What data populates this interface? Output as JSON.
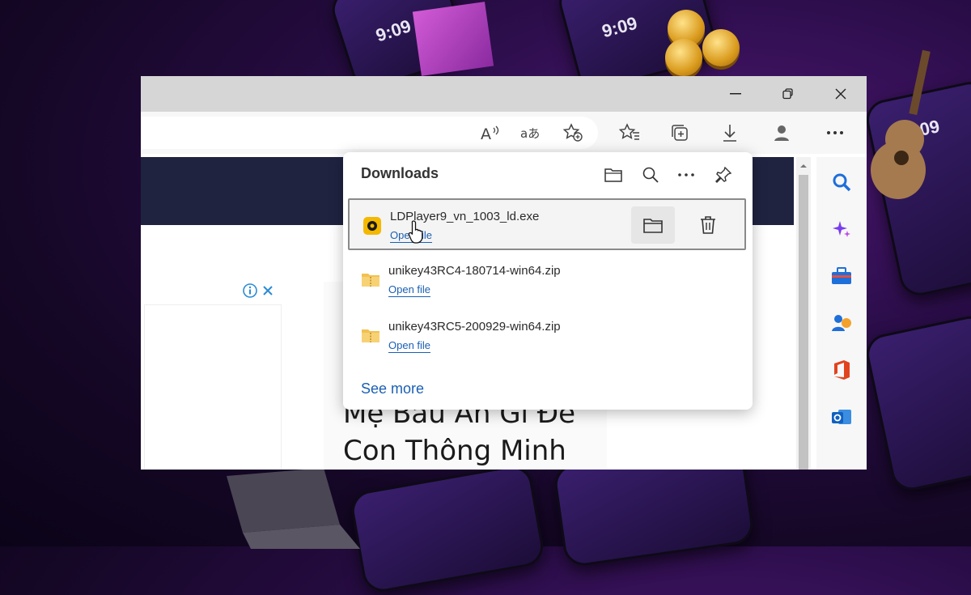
{
  "background": {
    "phone_clock": "9:09"
  },
  "window": {
    "controls": [
      "minimize",
      "restore",
      "close"
    ],
    "toolbar_icons": [
      "read-aloud-icon",
      "translate-icon",
      "add-favorite-icon",
      "favorites-icon",
      "collections-icon",
      "download-icon",
      "profile-icon",
      "more-icon"
    ]
  },
  "page": {
    "article_line1": "Mẹ Bầu Ăn Gì Để",
    "article_line2": "Con Thông Minh"
  },
  "downloads": {
    "title": "Downloads",
    "items": [
      {
        "name": "LDPlayer9_vn_1003_ld.exe",
        "action": "Open file",
        "icon": "ldplayer-icon"
      },
      {
        "name": "unikey43RC4-180714-win64.zip",
        "action": "Open file",
        "icon": "folder-zip-icon"
      },
      {
        "name": "unikey43RC5-200929-win64.zip",
        "action": "Open file",
        "icon": "folder-zip-icon"
      }
    ],
    "see_more": "See more"
  },
  "colors": {
    "link": "#1a5fb4",
    "navy": "#1f2340",
    "zip": "#f2c14e"
  }
}
